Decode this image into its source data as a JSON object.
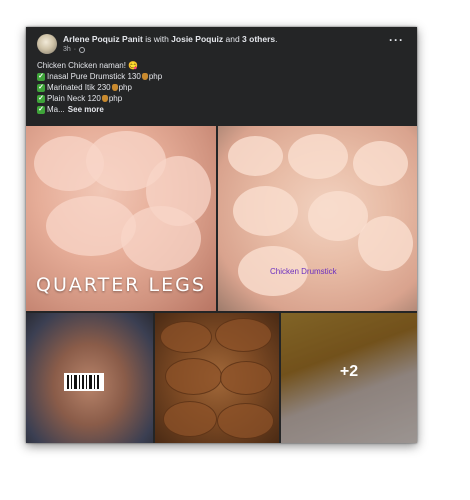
{
  "post": {
    "author": "Arlene Poquiz Panit",
    "with_text": " is with ",
    "tagged": "Josie Poquiz",
    "and_text": " and ",
    "others": "3 others",
    "period": ".",
    "time": "3h",
    "menu_icon": "more-options-icon"
  },
  "content": {
    "line0": "Chicken Chicken naman! 😋",
    "items": [
      {
        "label": "Inasal Pure Drumstick 130",
        "unit": "php"
      },
      {
        "label": "Marinated Itik 230",
        "unit": "php"
      },
      {
        "label": "Plain Neck 120",
        "unit": "php"
      }
    ],
    "truncated": "Ma...",
    "see_more": "See more"
  },
  "photos": {
    "photo1_caption": "QUARTER LEGS",
    "photo2_caption": "Chicken Drumstick",
    "more_count": "+2"
  }
}
